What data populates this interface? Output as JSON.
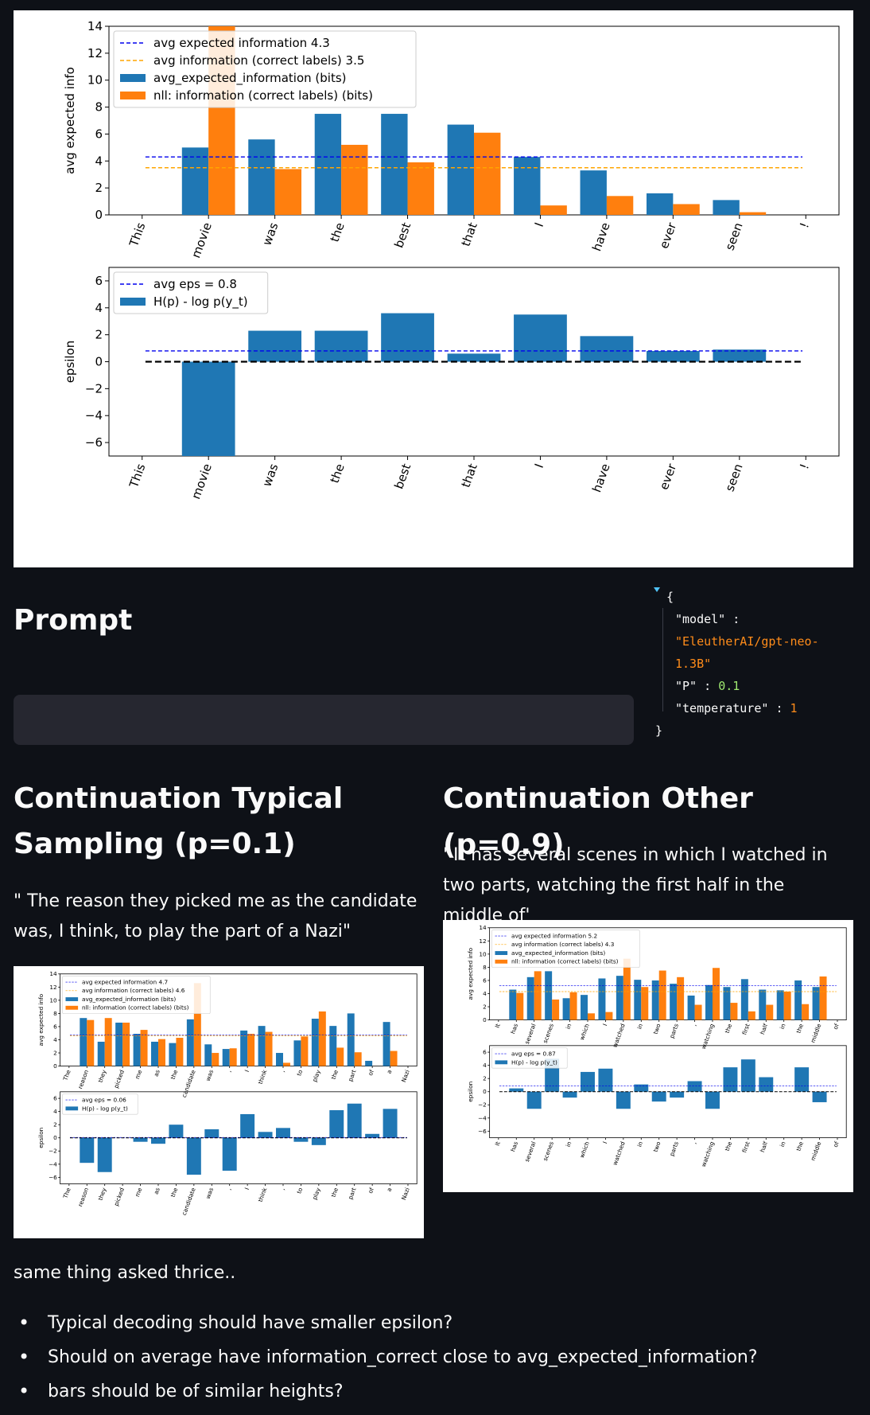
{
  "main_chart": {
    "chart_data": [
      {
        "type": "bar",
        "ylabel": "avg expected info",
        "ylim": [
          0,
          14
        ],
        "yticks": [
          0,
          2,
          4,
          6,
          8,
          10,
          12,
          14
        ],
        "categories": [
          "This",
          "movie",
          "was",
          "the",
          "best",
          "that",
          "I",
          "have",
          "ever",
          "seen",
          "!"
        ],
        "series": [
          {
            "name": "avg_expected_information (bits)",
            "color": "#1f77b4",
            "values": [
              0,
              5.0,
              5.6,
              7.5,
              7.5,
              6.7,
              4.3,
              3.3,
              1.6,
              1.1,
              0
            ]
          },
          {
            "name": "nll: information (correct labels) (bits)",
            "color": "#ff7f0e",
            "values": [
              0,
              14.5,
              3.4,
              5.2,
              3.9,
              6.1,
              0.7,
              1.4,
              0.8,
              0.2,
              0
            ]
          }
        ],
        "hlines": [
          {
            "name": "avg expected information 4.3",
            "value": 4.3,
            "color": "#0000ee"
          },
          {
            "name": "avg information (correct labels) 3.5",
            "value": 3.5,
            "color": "#ffa500"
          }
        ],
        "legend": "top-left",
        "grid": false
      },
      {
        "type": "bar",
        "ylabel": "epsilon",
        "ylim": [
          -7,
          7
        ],
        "yticks": [
          -6,
          -4,
          -2,
          0,
          2,
          4,
          6
        ],
        "categories": [
          "This",
          "movie",
          "was",
          "the",
          "best",
          "that",
          "I",
          "have",
          "ever",
          "seen",
          "!"
        ],
        "series": [
          {
            "name": "H(p) - log p(y_t)",
            "color": "#1f77b4",
            "values": [
              0,
              -7.2,
              2.3,
              2.3,
              3.6,
              0.6,
              3.5,
              1.9,
              0.8,
              0.9,
              0
            ]
          }
        ],
        "hlines": [
          {
            "name": "avg eps = 0.8",
            "value": 0.8,
            "color": "#0000ee"
          },
          {
            "name": "",
            "value": 0,
            "color": "#000000"
          }
        ],
        "legend": "top-left",
        "grid": false
      }
    ]
  },
  "prompt": {
    "title": "Prompt",
    "input_value": ""
  },
  "config": {
    "open_brace": "{",
    "close_brace": "}",
    "model_key": "\"model\"",
    "model_value": "\"EleutherAI/gpt-neo-1.3B\"",
    "model_value_line1": "\"EleutherAI/gpt-neo-",
    "model_value_line2": "1.3B\"",
    "p_key": "\"P\"",
    "p_value": "0.1",
    "temperature_key": "\"temperature\"",
    "temperature_value": "1",
    "colon": ":"
  },
  "typical": {
    "title_line1": "Continuation Typical",
    "title_line2": "Sampling (p=0.1)",
    "text": "\" The reason they picked me as the candidate was, I think, to play the part of a Nazi\"",
    "chart_data": [
      {
        "type": "bar",
        "ylabel": "avg expected info",
        "ylim": [
          0,
          14
        ],
        "yticks": [
          0,
          2,
          4,
          6,
          8,
          10,
          12,
          14
        ],
        "categories": [
          "The",
          "reason",
          "they",
          "picked",
          "me",
          "as",
          "the",
          "candidate",
          "was",
          ",",
          "I",
          "think",
          ",",
          "to",
          "play",
          "the",
          "part",
          "of",
          "a",
          "Nazi"
        ],
        "series": [
          {
            "name": "avg_expected_information (bits)",
            "color": "#1f77b4",
            "values": [
              0,
              7.3,
              3.7,
              6.6,
              4.9,
              3.7,
              3.5,
              7.1,
              3.3,
              2.6,
              5.4,
              6.1,
              2.0,
              3.9,
              7.2,
              6.1,
              8.0,
              0.8,
              6.7,
              0
            ]
          },
          {
            "name": "nll: information (correct labels) (bits)",
            "color": "#ff7f0e",
            "values": [
              0,
              7.0,
              7.3,
              6.6,
              5.5,
              4.1,
              4.3,
              12.6,
              2.0,
              2.7,
              4.9,
              5.2,
              0.5,
              4.5,
              8.3,
              2.8,
              2.1,
              0,
              2.3,
              0
            ]
          }
        ],
        "hlines": [
          {
            "name": "avg expected information 4.7",
            "value": 4.7,
            "color": "#0000ee"
          },
          {
            "name": "avg information (correct labels) 4.6",
            "value": 4.6,
            "color": "#ffa500"
          }
        ],
        "legend": "top-left",
        "grid": false
      },
      {
        "type": "bar",
        "ylabel": "epsilon",
        "ylim": [
          -7,
          7
        ],
        "yticks": [
          -6,
          -4,
          -2,
          0,
          2,
          4,
          6
        ],
        "categories": [
          "The",
          "reason",
          "they",
          "picked",
          "me",
          "as",
          "the",
          "candidate",
          "was",
          ",",
          "I",
          "think",
          ",",
          "to",
          "play",
          "the",
          "part",
          "of",
          "a",
          "Nazi"
        ],
        "series": [
          {
            "name": "H(p) - log p(y_t)",
            "color": "#1f77b4",
            "values": [
              0,
              -3.8,
              -5.2,
              0,
              -0.6,
              -0.9,
              2.0,
              -5.6,
              1.3,
              -5.0,
              3.6,
              0.9,
              1.5,
              -0.6,
              -1.1,
              4.2,
              5.2,
              0.6,
              4.4,
              0
            ]
          }
        ],
        "hlines": [
          {
            "name": "avg eps = 0.06",
            "value": 0.06,
            "color": "#0000ee"
          },
          {
            "name": "",
            "value": 0,
            "color": "#000000"
          }
        ],
        "legend": "top-left",
        "grid": false
      }
    ]
  },
  "other": {
    "title": "Continuation Other (p=0.9)",
    "text": "' It has several scenes in which I watched in two parts, watching the first half in the middle of'",
    "chart_data": [
      {
        "type": "bar",
        "ylabel": "avg expected info",
        "ylim": [
          0,
          14
        ],
        "yticks": [
          0,
          2,
          4,
          6,
          8,
          10,
          12,
          14
        ],
        "categories": [
          "It",
          "has",
          "several",
          "scenes",
          "in",
          "which",
          "I",
          "watched",
          "in",
          "two",
          "parts",
          ",",
          "watching",
          "the",
          "first",
          "half",
          "in",
          "the",
          "middle",
          "of"
        ],
        "series": [
          {
            "name": "avg_expected_information (bits)",
            "color": "#1f77b4",
            "values": [
              0,
              4.6,
              6.5,
              7.4,
              3.3,
              3.8,
              6.3,
              6.7,
              6.1,
              6.0,
              5.5,
              3.7,
              5.3,
              5.0,
              6.2,
              4.6,
              4.5,
              6.0,
              5.0,
              0
            ]
          },
          {
            "name": "nll: information (correct labels) (bits)",
            "color": "#ff7f0e",
            "values": [
              0,
              4.1,
              7.4,
              3.1,
              4.2,
              1.0,
              1.2,
              9.3,
              5.0,
              7.5,
              6.5,
              2.3,
              7.9,
              2.6,
              1.3,
              2.3,
              4.3,
              2.4,
              6.6,
              0
            ]
          }
        ],
        "hlines": [
          {
            "name": "avg expected information 5.2",
            "value": 5.2,
            "color": "#0000ee"
          },
          {
            "name": "avg information (correct labels) 4.3",
            "value": 4.3,
            "color": "#ffa500"
          }
        ],
        "legend": "top-left",
        "grid": false
      },
      {
        "type": "bar",
        "ylabel": "epsilon",
        "ylim": [
          -7,
          7
        ],
        "yticks": [
          -6,
          -4,
          -2,
          0,
          2,
          4,
          6
        ],
        "categories": [
          "It",
          "has",
          "several",
          "scenes",
          "in",
          "which",
          "I",
          "watched",
          "in",
          "two",
          "parts",
          ",",
          "watching",
          "the",
          "first",
          "half",
          "in",
          "the",
          "middle",
          "of"
        ],
        "series": [
          {
            "name": "H(p) - log p(y_t)",
            "color": "#1f77b4",
            "values": [
              0,
              0.5,
              -2.6,
              5.0,
              -0.9,
              3.0,
              3.5,
              -2.6,
              1.1,
              -1.5,
              -0.9,
              1.6,
              -2.6,
              3.7,
              4.9,
              2.2,
              0,
              3.7,
              -1.6,
              0
            ]
          }
        ],
        "hlines": [
          {
            "name": "avg eps = 0.87",
            "value": 0.87,
            "color": "#0000ee"
          },
          {
            "name": "",
            "value": 0,
            "color": "#000000"
          }
        ],
        "legend": "top-left",
        "grid": false
      }
    ]
  },
  "notes": {
    "intro": "same thing asked thrice..",
    "items": [
      "Typical decoding should have smaller epsilon?",
      "Should on average have information_correct close to avg_expected_information?",
      "bars should be of similar heights?"
    ]
  }
}
